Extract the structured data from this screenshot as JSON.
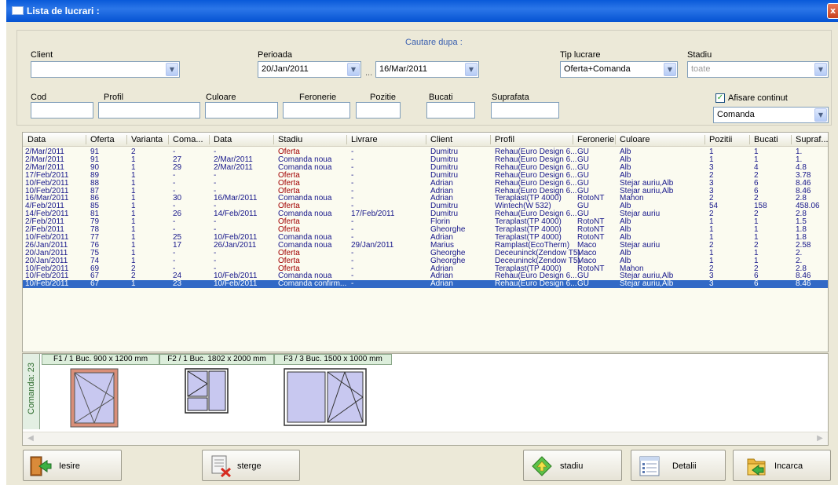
{
  "window": {
    "title": "Lista de lucrari :",
    "close_glyph": "x"
  },
  "search": {
    "heading": "Cautare dupa :",
    "client_label": "Client",
    "client_value": "",
    "period_label": "Perioada",
    "date_from": "20/Jan/2011",
    "date_sep": "...",
    "date_to": "16/Mar/2011",
    "tip_label": "Tip lucrare",
    "tip_value": "Oferta+Comanda",
    "stadiu_label": "Stadiu",
    "stadiu_value": "toate",
    "cod_label": "Cod",
    "profil_label": "Profil",
    "culoare_label": "Culoare",
    "feronerie_label": "Feronerie",
    "pozitie_label": "Pozitie",
    "bucati_label": "Bucati",
    "suprafata_label": "Suprafata",
    "afisare_label": "Afisare continut",
    "afisare_checked": true,
    "continut_value": "Comanda"
  },
  "table": {
    "columns": [
      "Data",
      "Oferta",
      "Varianta",
      "Coma...",
      "Data",
      "Stadiu",
      "Livrare",
      "Client",
      "Profil",
      "Feronerie",
      "Culoare",
      "Pozitii",
      "Bucati",
      "Supraf..."
    ],
    "rows": [
      [
        "2/Mar/2011",
        "91",
        "2",
        "-",
        "-",
        "Oferta",
        "-",
        "Dumitru",
        "Rehau(Euro Design 6...",
        "GU",
        "Alb",
        "1",
        "1",
        "1."
      ],
      [
        "2/Mar/2011",
        "91",
        "1",
        "27",
        "2/Mar/2011",
        "Comanda noua",
        "-",
        "Dumitru",
        "Rehau(Euro Design 6...",
        "GU",
        "Alb",
        "1",
        "1",
        "1."
      ],
      [
        "2/Mar/2011",
        "90",
        "1",
        "29",
        "2/Mar/2011",
        "Comanda noua",
        "-",
        "Dumitru",
        "Rehau(Euro Design 6...",
        "GU",
        "Alb",
        "3",
        "4",
        "4.8"
      ],
      [
        "17/Feb/2011",
        "89",
        "1",
        "-",
        "-",
        "Oferta",
        "-",
        "Dumitru",
        "Rehau(Euro Design 6...",
        "GU",
        "Alb",
        "2",
        "2",
        "3.78"
      ],
      [
        "10/Feb/2011",
        "88",
        "1",
        "-",
        "-",
        "Oferta",
        "-",
        "Adrian",
        "Rehau(Euro Design 6...",
        "GU",
        "Stejar auriu,Alb",
        "3",
        "6",
        "8.46"
      ],
      [
        "10/Feb/2011",
        "87",
        "1",
        "-",
        "-",
        "Oferta",
        "-",
        "Adrian",
        "Rehau(Euro Design 6...",
        "GU",
        "Stejar auriu,Alb",
        "3",
        "6",
        "8.46"
      ],
      [
        "16/Mar/2011",
        "86",
        "1",
        "30",
        "16/Mar/2011",
        "Comanda noua",
        "-",
        "Adrian",
        "Teraplast(TP 4000)",
        "RotoNT",
        "Mahon",
        "2",
        "2",
        "2.8"
      ],
      [
        "4/Feb/2011",
        "85",
        "1",
        "-",
        "-",
        "Oferta",
        "-",
        "Dumitru",
        "Wintech(W 532)",
        "GU",
        "Alb",
        "54",
        "158",
        "458.06"
      ],
      [
        "14/Feb/2011",
        "81",
        "1",
        "26",
        "14/Feb/2011",
        "Comanda noua",
        "17/Feb/2011",
        "Dumitru",
        "Rehau(Euro Design 6...",
        "GU",
        "Stejar auriu",
        "2",
        "2",
        "2.8"
      ],
      [
        "2/Feb/2011",
        "79",
        "1",
        "-",
        "-",
        "Oferta",
        "-",
        "Florin",
        "Teraplast(TP 4000)",
        "RotoNT",
        "Alb",
        "1",
        "1",
        "1.5"
      ],
      [
        "2/Feb/2011",
        "78",
        "1",
        "-",
        "-",
        "Oferta",
        "-",
        "Gheorghe",
        "Teraplast(TP 4000)",
        "RotoNT",
        "Alb",
        "1",
        "1",
        "1.8"
      ],
      [
        "10/Feb/2011",
        "77",
        "1",
        "25",
        "10/Feb/2011",
        "Comanda noua",
        "-",
        "Adrian",
        "Teraplast(TP 4000)",
        "RotoNT",
        "Alb",
        "1",
        "1",
        "1.8"
      ],
      [
        "26/Jan/2011",
        "76",
        "1",
        "17",
        "26/Jan/2011",
        "Comanda noua",
        "29/Jan/2011",
        "Marius",
        "Ramplast(EcoTherm)",
        "Maco",
        "Stejar auriu",
        "2",
        "2",
        "2.58"
      ],
      [
        "20/Jan/2011",
        "75",
        "1",
        "-",
        "-",
        "Oferta",
        "-",
        "Gheorghe",
        "Deceuninck(Zendow T5)",
        "Maco",
        "Alb",
        "1",
        "1",
        "2."
      ],
      [
        "20/Jan/2011",
        "74",
        "1",
        "-",
        "-",
        "Oferta",
        "-",
        "Gheorghe",
        "Deceuninck(Zendow T5)",
        "Maco",
        "Alb",
        "1",
        "1",
        "2."
      ],
      [
        "10/Feb/2011",
        "69",
        "2",
        "-",
        "-",
        "Oferta",
        "-",
        "Adrian",
        "Teraplast(TP 4000)",
        "RotoNT",
        "Mahon",
        "2",
        "2",
        "2.8"
      ],
      [
        "10/Feb/2011",
        "67",
        "2",
        "24",
        "10/Feb/2011",
        "Comanda noua",
        "-",
        "Adrian",
        "Rehau(Euro Design 6...",
        "GU",
        "Stejar auriu,Alb",
        "3",
        "6",
        "8.46"
      ],
      [
        "10/Feb/2011",
        "67",
        "1",
        "23",
        "10/Feb/2011",
        "Comanda confirm...",
        "-",
        "Adrian",
        "Rehau(Euro Design 6...",
        "GU",
        "Stejar auriu,Alb",
        "3",
        "6",
        "8.46"
      ]
    ],
    "selected_index": 17
  },
  "preview": {
    "side_label": "Comanda: 23",
    "tabs": [
      "F1 / 1 Buc.  900 x 1200 mm",
      "F2 / 1 Buc.  1802 x 2000 mm",
      "F3 / 3 Buc.  1500 x 1000 mm"
    ]
  },
  "buttons": {
    "iesire": "Iesire",
    "sterge": "sterge",
    "stadiu": "stadiu",
    "detalii": "Detalii",
    "incarca": "Incarca"
  },
  "colors": {
    "title_bar": "#0a5ad9",
    "selection": "#3169c6",
    "offer_text": "#a20000",
    "row_text": "#16168a"
  },
  "icons": [
    "window-icon",
    "close-icon",
    "dropdown-arrow-icon",
    "checkbox-icon",
    "exit-door-icon",
    "delete-icon",
    "stage-diamond-icon",
    "details-list-icon",
    "load-folder-icon"
  ]
}
